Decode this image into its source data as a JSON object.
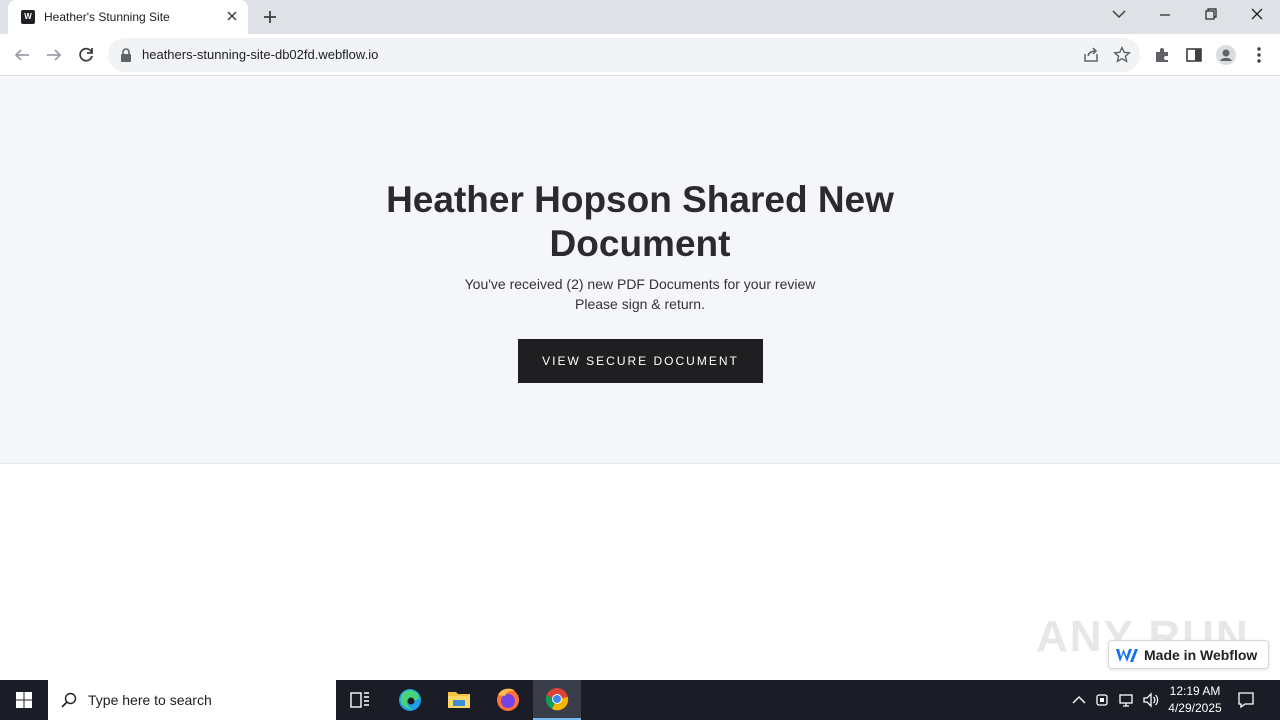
{
  "browser": {
    "tab_title": "Heather's Stunning Site",
    "favicon_letter": "W",
    "url": "heathers-stunning-site-db02fd.webflow.io"
  },
  "page": {
    "headline": "Heather Hopson Shared New Document",
    "subline1": "You've received (2) new PDF Documents for your review",
    "subline2": "Please sign & return.",
    "cta_label": "VIEW SECURE DOCUMENT",
    "badge_text": "Made in Webflow",
    "watermark": "ANY RUN"
  },
  "taskbar": {
    "search_placeholder": "Type here to search",
    "time": "12:19 AM",
    "date": "4/29/2025"
  },
  "colors": {
    "hero_bg": "#f4f6f9",
    "cta_bg": "#1f1f21",
    "taskbar_bg": "#1b1d26",
    "webflow_blue": "#146ef5"
  }
}
